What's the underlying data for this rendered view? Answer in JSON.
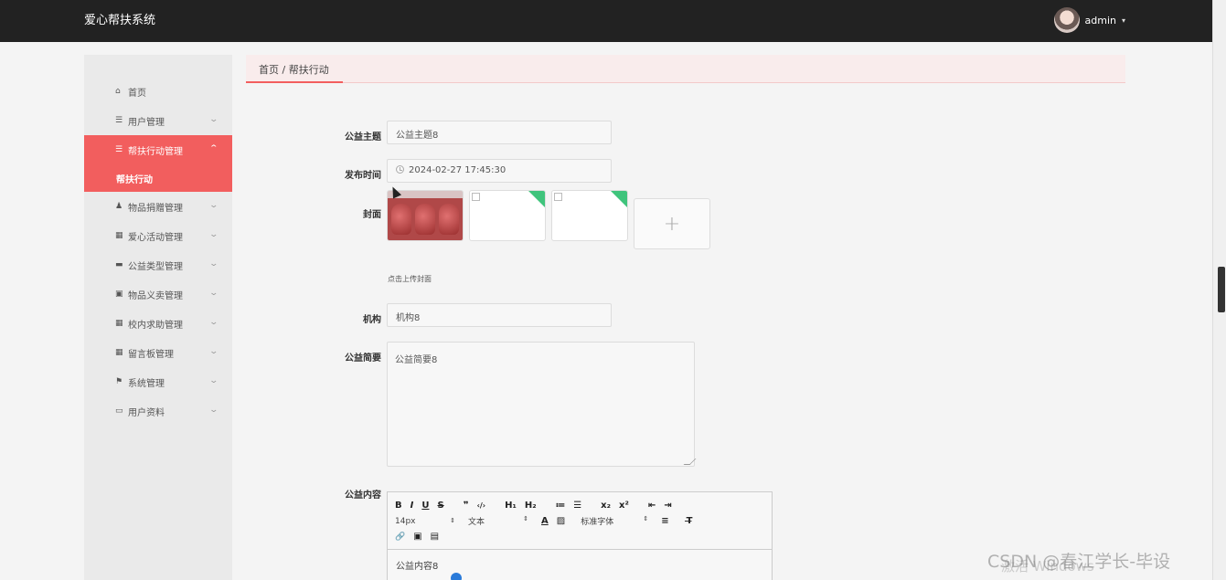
{
  "header": {
    "app_title": "爱心帮扶系统",
    "username": "admin",
    "caret": "▾"
  },
  "sidebar": {
    "items": [
      {
        "label": "首页",
        "icon": "home-icon",
        "glyph": "⌂"
      },
      {
        "label": "用户管理",
        "icon": "list-icon",
        "glyph": "☰"
      },
      {
        "label": "帮扶行动管理",
        "icon": "list-icon",
        "glyph": "☰",
        "active": true,
        "sub": [
          "帮扶行动"
        ]
      },
      {
        "label": "物品捐赠管理",
        "icon": "user-icon",
        "glyph": "♟"
      },
      {
        "label": "爱心活动管理",
        "icon": "grid-icon",
        "glyph": "▦"
      },
      {
        "label": "公益类型管理",
        "icon": "comment-icon",
        "glyph": "▬"
      },
      {
        "label": "物品义卖管理",
        "icon": "chart-icon",
        "glyph": "▣"
      },
      {
        "label": "校内求助管理",
        "icon": "grid-icon",
        "glyph": "▦"
      },
      {
        "label": "留言板管理",
        "icon": "grid-icon",
        "glyph": "▦"
      },
      {
        "label": "系统管理",
        "icon": "flag-icon",
        "glyph": "⚑"
      },
      {
        "label": "用户资料",
        "icon": "card-icon",
        "glyph": "▭"
      }
    ],
    "chevron_down": "⌄",
    "chevron_up": "⌃"
  },
  "breadcrumb": "首页 / 帮扶行动",
  "form": {
    "topic_label": "公益主题",
    "topic_value": "公益主题8",
    "time_label": "发布时间",
    "time_value": "2024-02-27 17:45:30",
    "cover_label": "封面",
    "upload_plus": "+",
    "upload_hint": "点击上传封面",
    "org_label": "机构",
    "org_value": "机构8",
    "summary_label": "公益简要",
    "summary_value": "公益简要8",
    "content_label": "公益内容",
    "content_value": "公益内容8"
  },
  "editor": {
    "row1": [
      "B",
      "I",
      "U",
      "S",
      "❞",
      "‹/›",
      "H₁",
      "H₂",
      "≔",
      "☰",
      "x₂",
      "x²",
      "⇤",
      "⇥"
    ],
    "font_size": "14px",
    "text_type": "文本",
    "font_family": "标准字体",
    "select_arrow": "⇕",
    "row2_btns": [
      "A",
      "▨",
      "≡",
      "T̶"
    ],
    "row3": [
      "🔗",
      "▣",
      "▤"
    ]
  },
  "watermark": "CSDN @春江学长-毕设",
  "watermark2": "激活 Windows"
}
